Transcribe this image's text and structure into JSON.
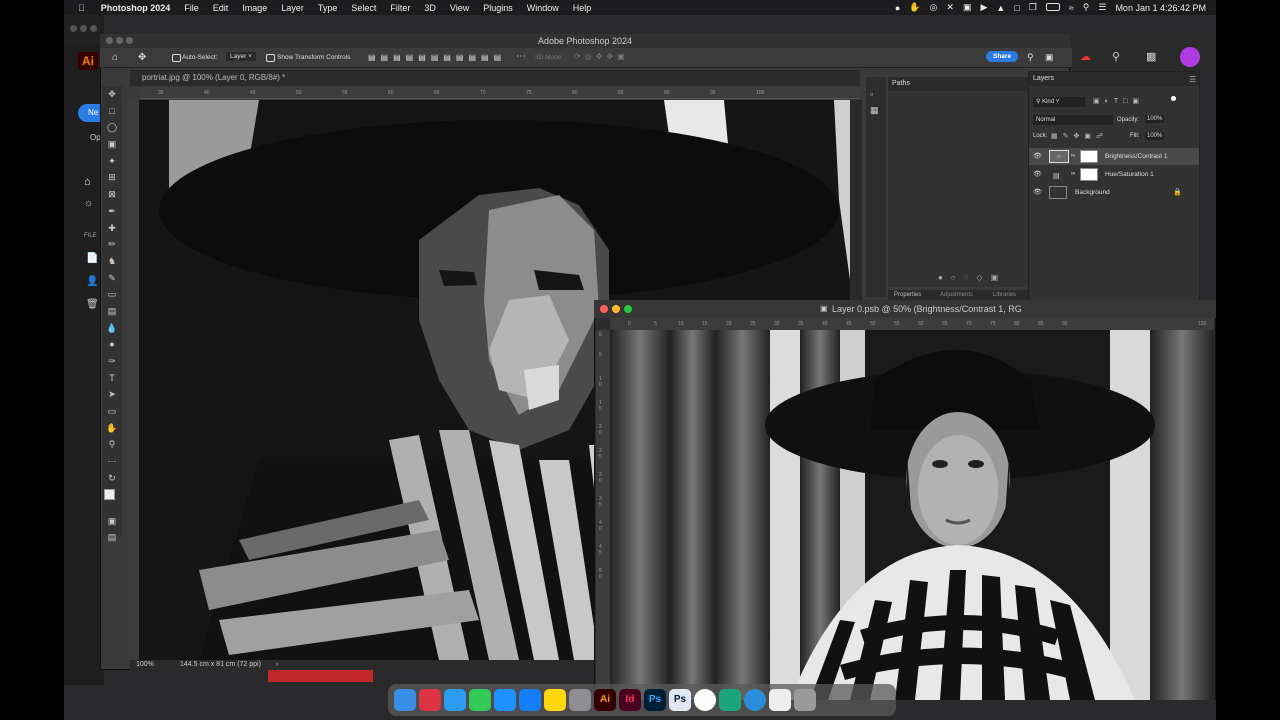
{
  "menubar": {
    "apple": "",
    "app_name": "Photoshop 2024",
    "items": [
      "File",
      "Edit",
      "Image",
      "Layer",
      "Type",
      "Select",
      "Filter",
      "3D",
      "View",
      "Plugins",
      "Window",
      "Help"
    ],
    "clock": "Mon Jan 1  4:26:42 PM"
  },
  "window": {
    "title": "Adobe Photoshop 2024"
  },
  "options": {
    "auto_select_label": "Auto-Select:",
    "auto_select_value": "Layer",
    "transform_label": "Show Transform Controls",
    "mode_3d": "3D Mode:",
    "share_label": "Share"
  },
  "home_side": {
    "new_label": "Ne",
    "open_label": "Op",
    "files_label": "FILE"
  },
  "doc1": {
    "tab_title": "portriat.jpg @ 100% (Layer 0, RGB/8#) *",
    "zoom": "100%",
    "dimensions": "144.5 cm x 81 cm (72 ppi)",
    "ruler_ticks": [
      "35",
      "40",
      "45",
      "50",
      "55",
      "60",
      "65",
      "70",
      "75",
      "80",
      "85",
      "90",
      "95",
      "100"
    ]
  },
  "paths_panel": {
    "title": "Paths",
    "tabs": [
      "Properties",
      "Adjustments",
      "Libraries"
    ]
  },
  "layers_panel": {
    "title": "Layers",
    "kind": "Kind",
    "blend": "Normal",
    "opacity_label": "Opacity:",
    "opacity_value": "100%",
    "lock_label": "Lock:",
    "fill_label": "Fill:",
    "fill_value": "100%",
    "layers": [
      {
        "name": "Brightness/Contrast 1"
      },
      {
        "name": "Hue/Saturation 1"
      },
      {
        "name": "Background"
      }
    ]
  },
  "doc2": {
    "title": "Layer 0.psb @ 50% (Brightness/Contrast 1, RG",
    "ruler_ticks": [
      "0",
      "5",
      "10",
      "15",
      "20",
      "25",
      "30",
      "35",
      "40",
      "45",
      "50",
      "55",
      "60",
      "65",
      "70",
      "75",
      "80",
      "85",
      "90"
    ],
    "side_ruler": [
      "0",
      "5",
      "1",
      "0",
      "1",
      "5",
      "2",
      "0",
      "2",
      "5",
      "3",
      "0",
      "3",
      "5",
      "4",
      "0",
      "4",
      "5",
      "5",
      "0"
    ],
    "right_tick": "130"
  },
  "colors": {
    "accent_blue": "#2c7be5",
    "adobe_red": "#ff0000",
    "dock_bg": "#5a5a5a"
  },
  "dock": [
    {
      "name": "finder",
      "label": ""
    },
    {
      "name": "launchpad",
      "label": ""
    },
    {
      "name": "safari",
      "label": ""
    },
    {
      "name": "messages",
      "label": ""
    },
    {
      "name": "mail",
      "label": ""
    },
    {
      "name": "appstore",
      "label": ""
    },
    {
      "name": "notes",
      "label": ""
    },
    {
      "name": "settings",
      "label": ""
    },
    {
      "name": "illustrator",
      "label": "Ai"
    },
    {
      "name": "indesign",
      "label": "Id"
    },
    {
      "name": "photoshop",
      "label": "Ps"
    },
    {
      "name": "photoshop-beta",
      "label": "Ps"
    },
    {
      "name": "chrome",
      "label": ""
    },
    {
      "name": "app-s",
      "label": ""
    },
    {
      "name": "app-q",
      "label": ""
    },
    {
      "name": "file",
      "label": ""
    },
    {
      "name": "trash",
      "label": ""
    }
  ]
}
